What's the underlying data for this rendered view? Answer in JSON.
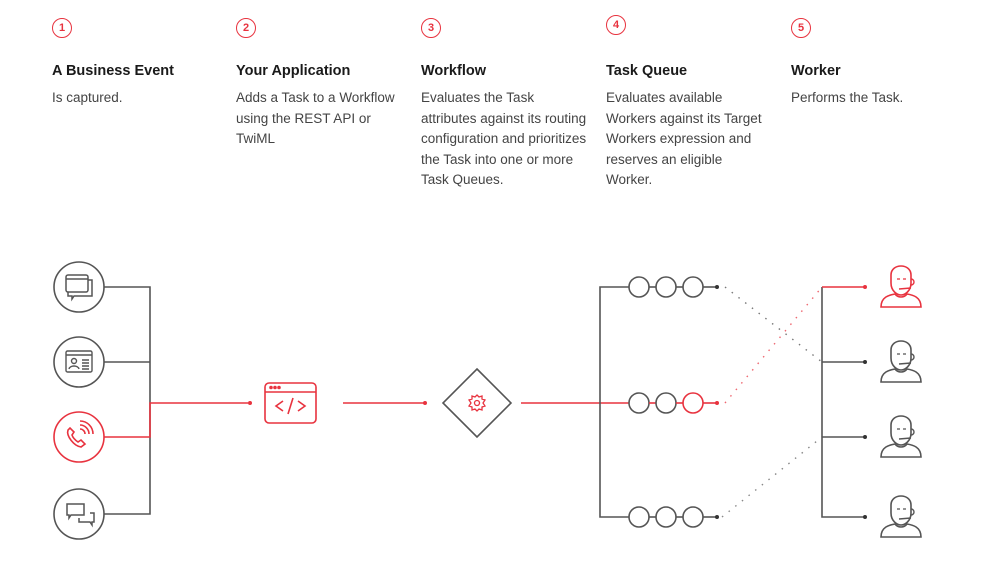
{
  "steps": [
    {
      "number": "1",
      "title": "A Business Event",
      "description": "Is captured."
    },
    {
      "number": "2",
      "title": "Your Application",
      "description": "Adds a Task to a Workflow using the REST API or TwiML"
    },
    {
      "number": "3",
      "title": "Workflow",
      "description": "Evaluates the Task attributes against its routing configuration and prioritizes the Task into one or more Task Queues."
    },
    {
      "number": "4",
      "title": "Task Queue",
      "description": "Evaluates available Workers against its Target Workers expression and reserves an eligible Worker."
    },
    {
      "number": "5",
      "title": "Worker",
      "description": "Performs the Task."
    }
  ],
  "diagram": {
    "colors": {
      "accent": "#e8333f",
      "neutral": "#555555"
    },
    "event_sources": [
      {
        "icon": "browser-chat-icon",
        "active": false
      },
      {
        "icon": "contact-form-icon",
        "active": false
      },
      {
        "icon": "phone-call-icon",
        "active": true
      },
      {
        "icon": "chat-bubbles-icon",
        "active": false
      }
    ],
    "application_icon": "code-window-icon",
    "workflow_icon": "gear-diamond-icon",
    "task_queues": [
      {
        "slots": 3,
        "active": false
      },
      {
        "slots": 3,
        "active": true,
        "active_slot": 3
      },
      {
        "slots": 3,
        "active": false
      }
    ],
    "workers": [
      {
        "icon": "agent-headset-icon",
        "active": true
      },
      {
        "icon": "agent-headset-icon",
        "active": false
      },
      {
        "icon": "agent-headset-icon",
        "active": false
      },
      {
        "icon": "agent-headset-icon",
        "active": false
      }
    ]
  }
}
